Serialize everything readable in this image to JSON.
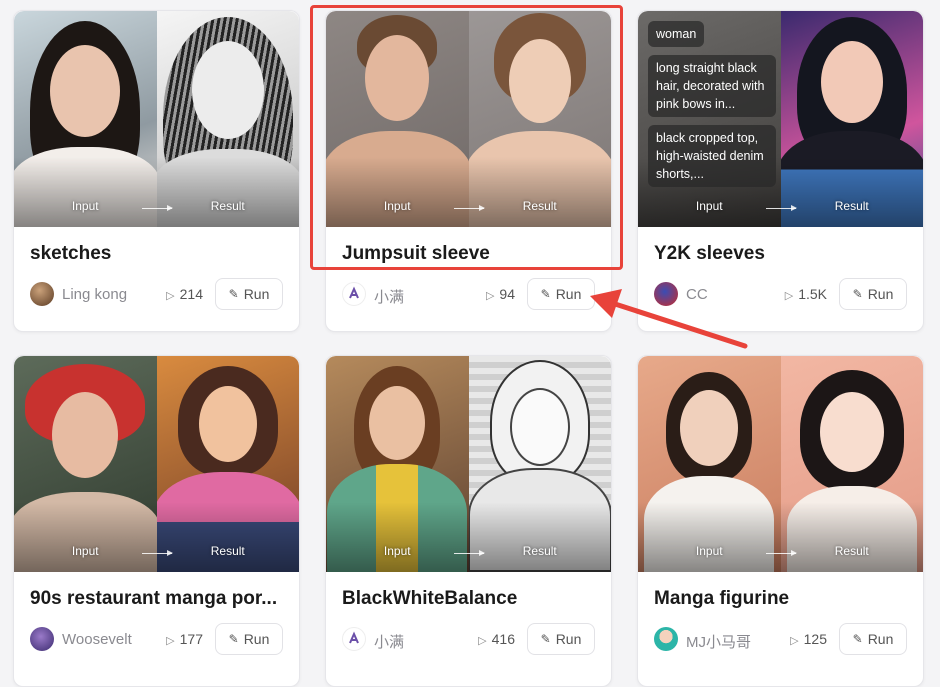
{
  "labels": {
    "input": "Input",
    "result": "Result",
    "run": "Run"
  },
  "cards": [
    {
      "title": "sketches",
      "author": "Ling kong",
      "runs": "214"
    },
    {
      "title": "Jumpsuit sleeve",
      "author": "小满",
      "runs": "94"
    },
    {
      "title": "Y2K sleeves",
      "author": "CC",
      "runs": "1.5K",
      "prompt_tags": [
        "woman",
        "long straight black hair, decorated with pink bows in...",
        "black cropped top, high-waisted denim shorts,..."
      ]
    },
    {
      "title": "90s restaurant manga por...",
      "author": "Woosevelt",
      "runs": "177"
    },
    {
      "title": "BlackWhiteBalance",
      "author": "小满",
      "runs": "416"
    },
    {
      "title": "Manga figurine",
      "author": "MJ小马哥",
      "runs": "125"
    }
  ],
  "annotation": {
    "color": "#e8433a",
    "highlighted_card": "Jumpsuit sleeve"
  },
  "icons": {
    "play": "play-icon",
    "run": "magic-wand-icon",
    "arrow": "arrow-right-icon"
  }
}
